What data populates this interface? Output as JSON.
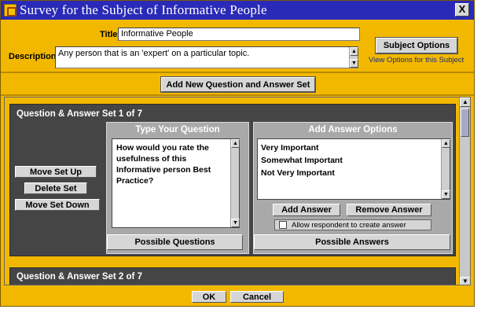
{
  "window": {
    "title": "Survey for the Subject of Informative People",
    "close_glyph": "X"
  },
  "form": {
    "title_label": "Title",
    "title_value": "Informative People",
    "description_label": "Description",
    "description_value": "Any person that is an 'expert' on a particular topic.",
    "subject_options_label": "Subject Options",
    "view_options_link": "View Options for this Subject",
    "add_set_label": "Add New Question and Answer Set"
  },
  "sets": [
    {
      "header": "Question & Answer Set 1 of 7",
      "move_up_label": "Move Set Up",
      "delete_label": "Delete Set",
      "move_down_label": "Move Set Down",
      "question_panel_title": "Type Your Question",
      "question_text": "How would you rate the usefulness of this Informative person Best Practice?",
      "possible_questions_label": "Possible Questions",
      "answer_panel_title": "Add Answer Options",
      "answer_options": [
        "Very Important",
        "Somewhat Important",
        "Not Very Important"
      ],
      "add_answer_label": "Add Answer",
      "remove_answer_label": "Remove Answer",
      "allow_create_label": "Allow respondent to create answer",
      "possible_answers_label": "Possible Answers"
    },
    {
      "header": "Question & Answer Set 2 of 7"
    }
  ],
  "footer": {
    "ok_label": "OK",
    "cancel_label": "Cancel"
  },
  "colors": {
    "window_bg": "#f2b800",
    "titlebar": "#2a2ab8",
    "panel_dark": "#454545",
    "subpanel": "#a9a9a9"
  }
}
